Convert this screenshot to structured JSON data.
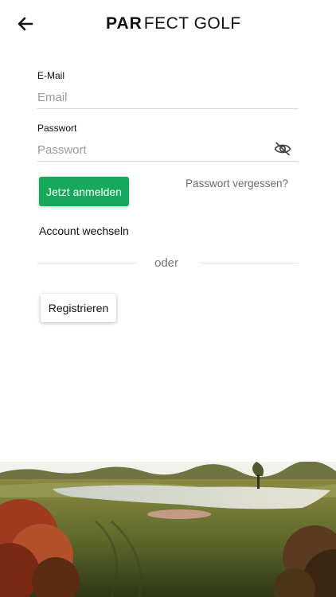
{
  "header": {
    "back_icon": "arrow-left-icon",
    "logo_par": "PAR",
    "logo_fect": "FECT GOLF"
  },
  "login": {
    "email_label": "E-Mail",
    "email_placeholder": "Email",
    "email_value": "",
    "password_label": "Passwort",
    "password_placeholder": "Passwort",
    "password_value": "",
    "password_toggle_icon": "eye-off-icon",
    "submit_label": "Jetzt anmelden",
    "forgot_label": "Passwort vergessen?",
    "switch_account_label": "Account wechseln"
  },
  "separator": {
    "text": "oder"
  },
  "register": {
    "label": "Registrieren"
  },
  "hero": {
    "image": "golf-course-landscape-photo"
  },
  "colors": {
    "accent": "#17a85c",
    "text": "#111111",
    "muted": "#6b6b6b",
    "divider": "#e2e2e2"
  }
}
